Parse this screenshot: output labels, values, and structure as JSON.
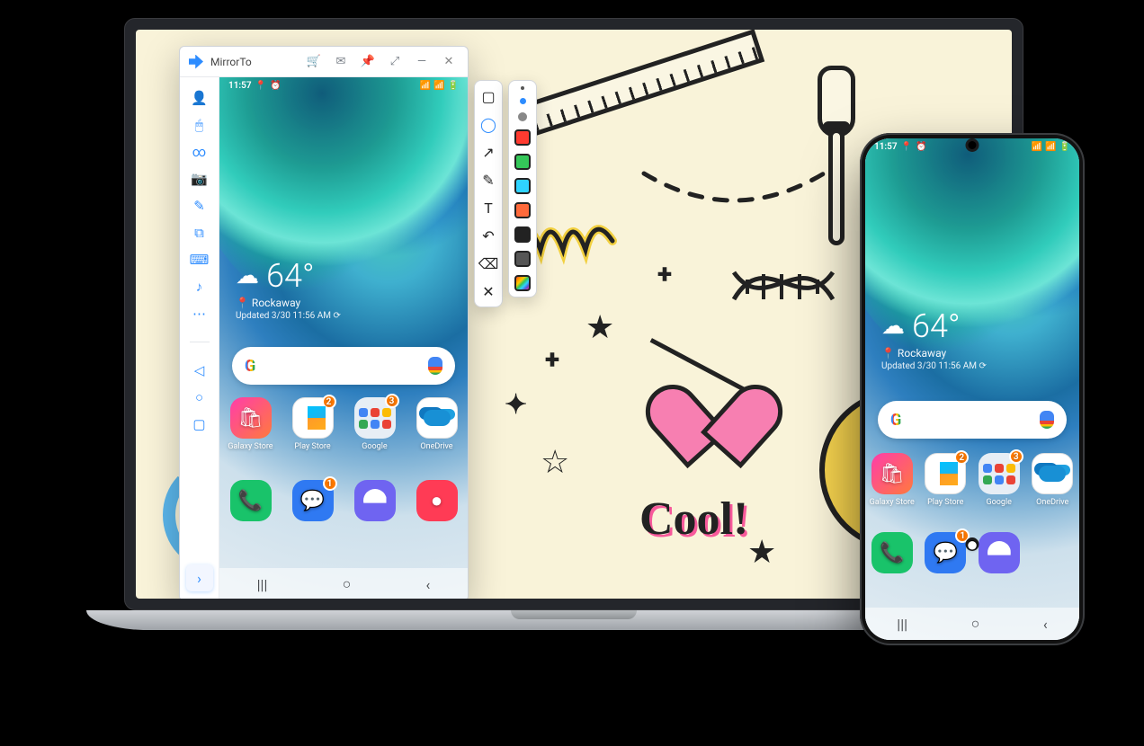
{
  "app": {
    "title": "MirrorTo"
  },
  "titlebar_icons": [
    "cart",
    "mail",
    "pin",
    "fullscreen",
    "minimize",
    "close"
  ],
  "sidebar": {
    "items": [
      {
        "id": "account",
        "glyph": "👤"
      },
      {
        "id": "mouse",
        "glyph": "🖱"
      },
      {
        "id": "stream",
        "glyph": "∞"
      },
      {
        "id": "screenshot",
        "glyph": "📷"
      },
      {
        "id": "annotate",
        "glyph": "✎"
      },
      {
        "id": "record",
        "glyph": "⧉"
      },
      {
        "id": "keyboard",
        "glyph": "⌨"
      },
      {
        "id": "music",
        "glyph": "♪"
      },
      {
        "id": "more",
        "glyph": "⋯"
      }
    ],
    "nav": [
      {
        "id": "back",
        "glyph": "◁"
      },
      {
        "id": "home",
        "glyph": "○"
      },
      {
        "id": "recent",
        "glyph": "▢"
      }
    ],
    "collapse_glyph": "›"
  },
  "annotate": {
    "shapes": [
      {
        "id": "rect",
        "glyph": "▢"
      },
      {
        "id": "circle",
        "glyph": "◯",
        "color": "#2d8cff"
      },
      {
        "id": "arrow",
        "glyph": "↗"
      },
      {
        "id": "pen",
        "glyph": "✎"
      },
      {
        "id": "text",
        "glyph": "T"
      },
      {
        "id": "undo",
        "glyph": "↶"
      },
      {
        "id": "erase",
        "glyph": "⌫"
      },
      {
        "id": "exit",
        "glyph": "✕"
      }
    ],
    "sizes": [
      "#555",
      "#2d8cff",
      "#888"
    ],
    "colors": [
      "#ff3b30",
      "#34c759",
      "#2fd3ff",
      "#ff6a3b",
      "#222222",
      "#555555",
      "rainbow"
    ]
  },
  "phone": {
    "time": "11:57",
    "status_icons": [
      "📍",
      "⏰",
      "📶",
      "📶",
      "🔋"
    ],
    "temp": "64°",
    "location": "Rockaway",
    "updated": "Updated 3/30 11:56 AM ⟳",
    "apps_row1": [
      {
        "id": "galaxy",
        "label": "Galaxy Store",
        "badge": null
      },
      {
        "id": "play",
        "label": "Play Store",
        "badge": "2"
      },
      {
        "id": "folder",
        "label": "Google",
        "badge": "3"
      },
      {
        "id": "onedr",
        "label": "OneDrive",
        "badge": null
      }
    ],
    "apps_row2": [
      {
        "id": "phone",
        "label": "",
        "badge": null
      },
      {
        "id": "msgs",
        "label": "",
        "badge": "1"
      },
      {
        "id": "net",
        "label": "",
        "badge": null
      },
      {
        "id": "cam",
        "label": "",
        "badge": null
      }
    ],
    "nav": [
      "|||",
      "○",
      "‹"
    ]
  },
  "doodle": {
    "text": "Cool!"
  }
}
